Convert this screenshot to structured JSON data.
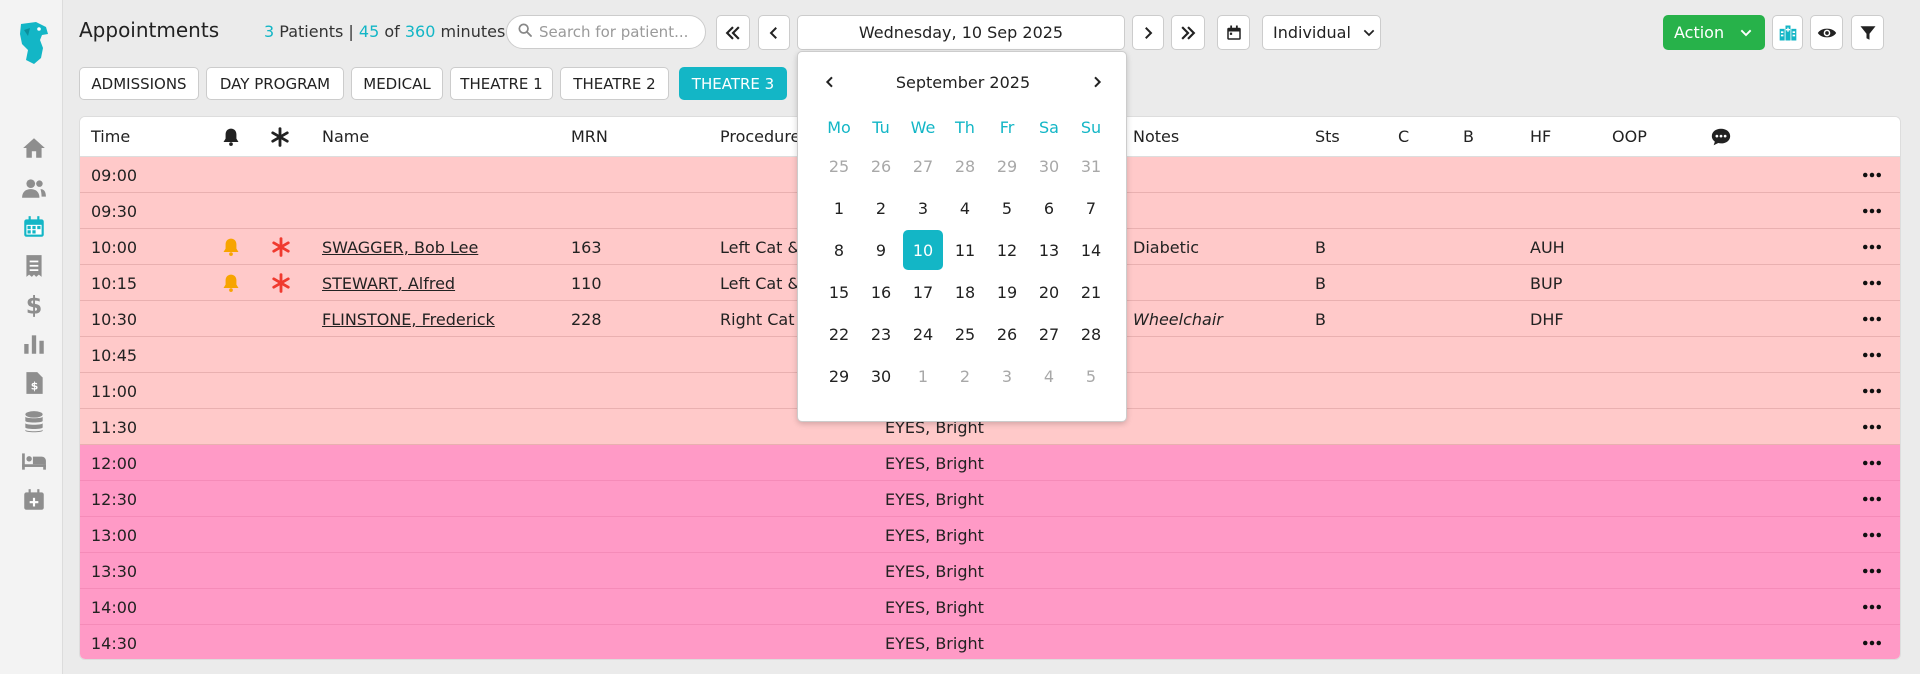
{
  "header": {
    "title": "Appointments",
    "summary": {
      "patients_count": "3",
      "patients_label": "Patients",
      "separator": "|",
      "used_minutes": "45",
      "of_label": "of",
      "total_minutes": "360",
      "minutes_label": "minutes"
    },
    "search_placeholder": "Search for patient...",
    "date": "Wednesday, 10 Sep 2025",
    "view_select": "Individual",
    "action_label": "Action"
  },
  "tabs": [
    {
      "label": "ADMISSIONS",
      "active": false
    },
    {
      "label": "DAY PROGRAM",
      "active": false
    },
    {
      "label": "MEDICAL",
      "active": false
    },
    {
      "label": "THEATRE 1",
      "active": false
    },
    {
      "label": "THEATRE 2",
      "active": false
    },
    {
      "label": "THEATRE 3",
      "active": true
    }
  ],
  "table": {
    "columns": {
      "time": "Time",
      "alert_icon": "bell-icon",
      "flag_icon": "asterisk-icon",
      "name": "Name",
      "mrn": "MRN",
      "procedure": "Procedure",
      "notes": "Notes",
      "sts": "Sts",
      "c": "C",
      "b": "B",
      "hf": "HF",
      "oop": "OOP",
      "comments_icon": "comment-dots-icon"
    },
    "rows": [
      {
        "time": "09:00",
        "bell": false,
        "flag": false,
        "name": "",
        "mrn": "",
        "procedure": "",
        "doctor": "",
        "notes": "",
        "sts": "",
        "hf": "",
        "shade": "light"
      },
      {
        "time": "09:30",
        "bell": false,
        "flag": false,
        "name": "",
        "mrn": "",
        "procedure": "",
        "doctor": "",
        "notes": "",
        "sts": "",
        "hf": "",
        "shade": "light"
      },
      {
        "time": "10:00",
        "bell": true,
        "flag": true,
        "name": "SWAGGER, Bob Lee",
        "mrn": "163",
        "procedure": "Left Cat &",
        "doctor": "",
        "notes": "Diabetic",
        "sts": "B",
        "hf": "AUH",
        "shade": "light"
      },
      {
        "time": "10:15",
        "bell": true,
        "flag": true,
        "name": "STEWART, Alfred",
        "mrn": "110",
        "procedure": "Left Cat &",
        "doctor": "",
        "notes": "",
        "sts": "B",
        "hf": "BUP",
        "shade": "light"
      },
      {
        "time": "10:30",
        "bell": false,
        "flag": false,
        "name": "FLINSTONE, Frederick",
        "mrn": "228",
        "procedure": "Right Cat &",
        "doctor": "",
        "notes": "Wheelchair",
        "sts": "B",
        "hf": "DHF",
        "shade": "light"
      },
      {
        "time": "10:45",
        "bell": false,
        "flag": false,
        "name": "",
        "mrn": "",
        "procedure": "",
        "doctor": "",
        "notes": "",
        "sts": "",
        "hf": "",
        "shade": "light"
      },
      {
        "time": "11:00",
        "bell": false,
        "flag": false,
        "name": "",
        "mrn": "",
        "procedure": "",
        "doctor": "",
        "notes": "",
        "sts": "",
        "hf": "",
        "shade": "light"
      },
      {
        "time": "11:30",
        "bell": false,
        "flag": false,
        "name": "",
        "mrn": "",
        "procedure": "",
        "doctor": "EYES, Bright",
        "notes": "",
        "sts": "",
        "hf": "",
        "shade": "light"
      },
      {
        "time": "12:00",
        "bell": false,
        "flag": false,
        "name": "",
        "mrn": "",
        "procedure": "",
        "doctor": "EYES, Bright",
        "notes": "",
        "sts": "",
        "hf": "",
        "shade": "dark"
      },
      {
        "time": "12:30",
        "bell": false,
        "flag": false,
        "name": "",
        "mrn": "",
        "procedure": "",
        "doctor": "EYES, Bright",
        "notes": "",
        "sts": "",
        "hf": "",
        "shade": "dark"
      },
      {
        "time": "13:00",
        "bell": false,
        "flag": false,
        "name": "",
        "mrn": "",
        "procedure": "",
        "doctor": "EYES, Bright",
        "notes": "",
        "sts": "",
        "hf": "",
        "shade": "dark"
      },
      {
        "time": "13:30",
        "bell": false,
        "flag": false,
        "name": "",
        "mrn": "",
        "procedure": "",
        "doctor": "EYES, Bright",
        "notes": "",
        "sts": "",
        "hf": "",
        "shade": "dark"
      },
      {
        "time": "14:00",
        "bell": false,
        "flag": false,
        "name": "",
        "mrn": "",
        "procedure": "",
        "doctor": "EYES, Bright",
        "notes": "",
        "sts": "",
        "hf": "",
        "shade": "dark"
      },
      {
        "time": "14:30",
        "bell": false,
        "flag": false,
        "name": "",
        "mrn": "",
        "procedure": "",
        "doctor": "EYES, Bright",
        "notes": "",
        "sts": "",
        "hf": "",
        "shade": "dark"
      }
    ]
  },
  "datepicker": {
    "month_label": "September 2025",
    "weekdays": [
      "Mo",
      "Tu",
      "We",
      "Th",
      "Fr",
      "Sa",
      "Su"
    ],
    "weeks": [
      [
        {
          "d": "25",
          "m": true
        },
        {
          "d": "26",
          "m": true
        },
        {
          "d": "27",
          "m": true
        },
        {
          "d": "28",
          "m": true
        },
        {
          "d": "29",
          "m": true
        },
        {
          "d": "30",
          "m": true
        },
        {
          "d": "31",
          "m": true
        }
      ],
      [
        {
          "d": "1"
        },
        {
          "d": "2"
        },
        {
          "d": "3"
        },
        {
          "d": "4"
        },
        {
          "d": "5"
        },
        {
          "d": "6"
        },
        {
          "d": "7"
        }
      ],
      [
        {
          "d": "8"
        },
        {
          "d": "9"
        },
        {
          "d": "10",
          "sel": true
        },
        {
          "d": "11"
        },
        {
          "d": "12"
        },
        {
          "d": "13"
        },
        {
          "d": "14"
        }
      ],
      [
        {
          "d": "15"
        },
        {
          "d": "16"
        },
        {
          "d": "17"
        },
        {
          "d": "18"
        },
        {
          "d": "19"
        },
        {
          "d": "20"
        },
        {
          "d": "21"
        }
      ],
      [
        {
          "d": "22"
        },
        {
          "d": "23"
        },
        {
          "d": "24"
        },
        {
          "d": "25"
        },
        {
          "d": "26"
        },
        {
          "d": "27"
        },
        {
          "d": "28"
        }
      ],
      [
        {
          "d": "29"
        },
        {
          "d": "30"
        },
        {
          "d": "1",
          "m": true
        },
        {
          "d": "2",
          "m": true
        },
        {
          "d": "3",
          "m": true
        },
        {
          "d": "4",
          "m": true
        },
        {
          "d": "5",
          "m": true
        }
      ]
    ]
  },
  "sidebar": {
    "icons": [
      "home-icon",
      "users-icon",
      "calendar-icon",
      "receipt-icon",
      "dollar-icon",
      "bar-chart-icon",
      "invoice-icon",
      "database-icon",
      "bed-icon",
      "calendar-plus-icon"
    ]
  },
  "colors": {
    "accent": "#13b6c6",
    "action_green": "#27b24a",
    "row_light": "#ffc9c9",
    "row_dark": "#ff9ac6",
    "bell_orange": "#f7a400",
    "flag_red": "#f03a2f"
  }
}
